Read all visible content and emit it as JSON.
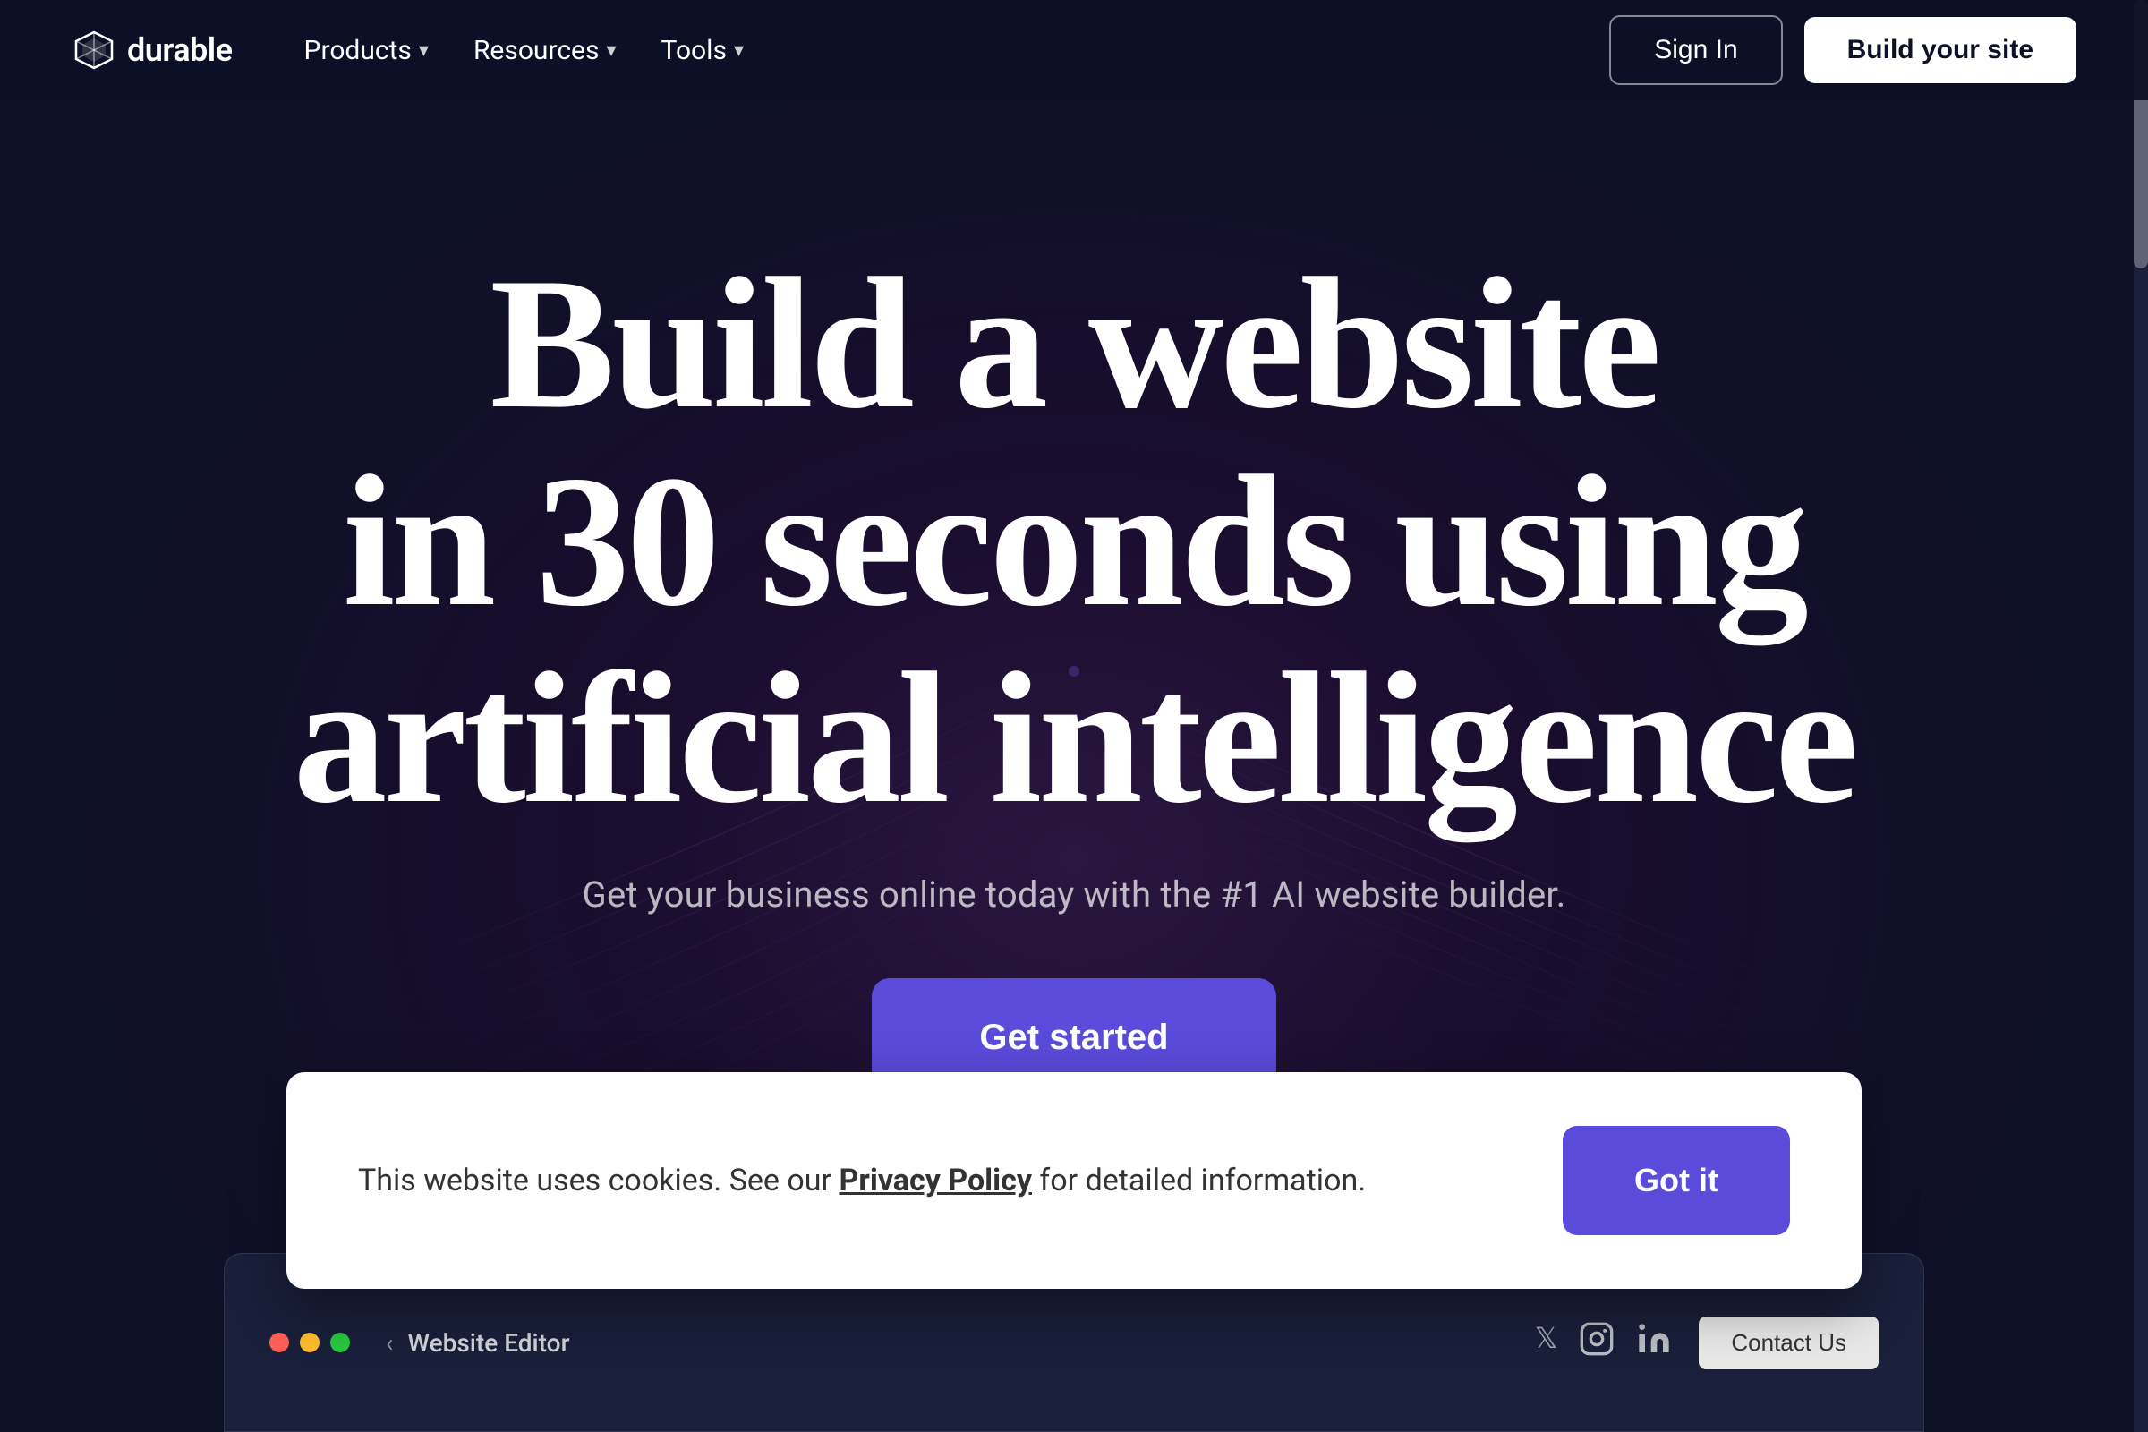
{
  "navbar": {
    "logo_text": "durable",
    "nav_items": [
      {
        "label": "Products",
        "has_chevron": true
      },
      {
        "label": "Resources",
        "has_chevron": true
      },
      {
        "label": "Tools",
        "has_chevron": true
      }
    ],
    "signin_label": "Sign In",
    "build_label": "Build your site"
  },
  "hero": {
    "title_line1": "Build a website",
    "title_line2": "in 30 seconds using",
    "title_line3": "artificial intelligence",
    "subtitle": "Get your business online today with the #1 AI website builder.",
    "cta_label": "Get started"
  },
  "browser": {
    "editor_label": "Website Editor",
    "contact_label": "Contact Us"
  },
  "cookie": {
    "text_prefix": "This website uses cookies. See our ",
    "privacy_link": "Privacy Policy",
    "text_suffix": " for detailed information.",
    "got_it_label": "Got it"
  },
  "icons": {
    "chevron": "▾",
    "back_arrow": "‹",
    "lightning": "⚡",
    "gear": "⚙",
    "question": "?",
    "external": "↗",
    "twitter": "𝕏",
    "instagram": "📷",
    "linkedin": "in"
  }
}
